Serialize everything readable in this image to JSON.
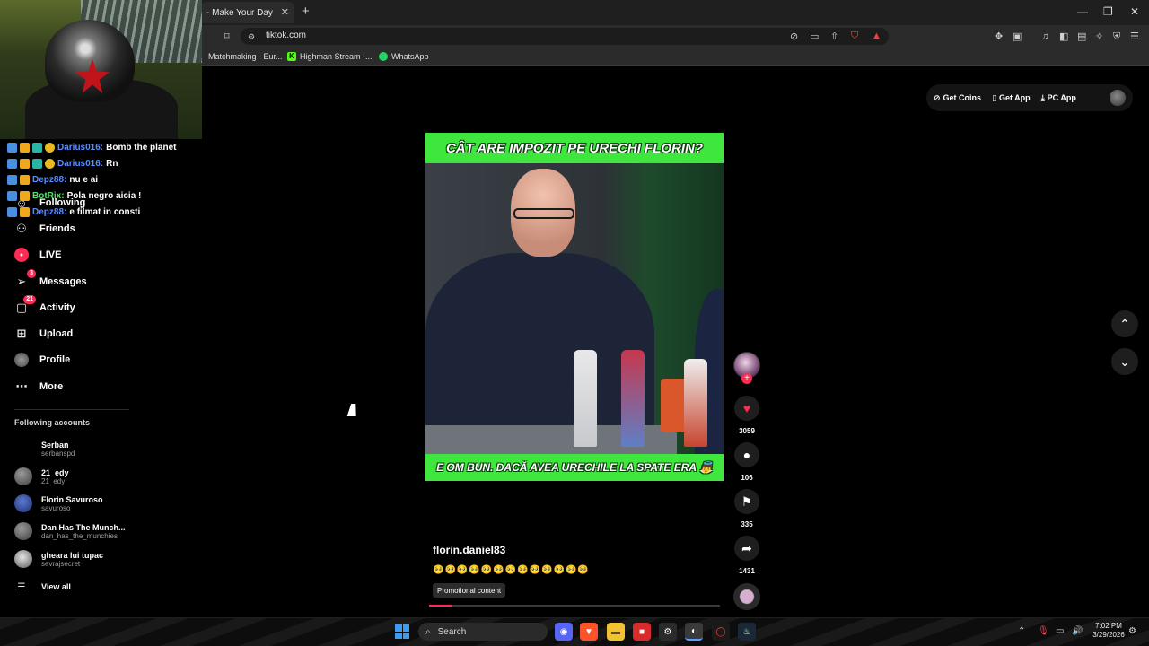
{
  "browser": {
    "tab_title": "- Make Your Day",
    "tab_close": "✕",
    "new_tab": "+",
    "url": "tiktok.com",
    "bookmarks": [
      {
        "label": "Matchmaking - Eur...",
        "icon": "bookmark-globe-icon",
        "color": "#888888"
      },
      {
        "label": "Highman Stream -...",
        "icon": "kick-icon",
        "color": "#53fc18"
      },
      {
        "label": "WhatsApp",
        "icon": "whatsapp-icon",
        "color": "#25d366"
      }
    ],
    "window_controls": [
      "—",
      "❐",
      "✕"
    ]
  },
  "chat": [
    {
      "user": "Darius016:",
      "message": "Bomb the planet",
      "user_color": "blue"
    },
    {
      "user": "Darius016:",
      "message": "Rn",
      "user_color": "blue"
    },
    {
      "user": "Depz88:",
      "message": "nu e ai",
      "user_color": "blue"
    },
    {
      "user": "BotRix:",
      "message": "Pola negro aicia !",
      "user_color": "green"
    },
    {
      "user": "Depz88:",
      "message": "e filmat in consti",
      "user_color": "blue"
    }
  ],
  "sidebar": {
    "items": [
      {
        "label": "Following",
        "icon": "following-icon"
      },
      {
        "label": "Friends",
        "icon": "friends-icon"
      },
      {
        "label": "LIVE",
        "icon": "live-icon"
      },
      {
        "label": "Messages",
        "icon": "messages-icon",
        "badge": "3"
      },
      {
        "label": "Activity",
        "icon": "activity-icon",
        "badge": "21"
      },
      {
        "label": "Upload",
        "icon": "upload-icon"
      },
      {
        "label": "Profile",
        "icon": "profile-icon"
      },
      {
        "label": "More",
        "icon": "more-icon"
      }
    ],
    "following_title": "Following accounts",
    "accounts": [
      {
        "name": "Serban",
        "handle": "serbanspd"
      },
      {
        "name": "21_edy",
        "handle": "21_edy"
      },
      {
        "name": "Florin Savuroso",
        "handle": "savuroso"
      },
      {
        "name": "Dan Has The Munch...",
        "handle": "dan_has_the_munchies"
      },
      {
        "name": "gheara lui tupac",
        "handle": "sevrajsecret"
      }
    ],
    "view_all": "View all"
  },
  "top_actions": {
    "get_coins": "Get Coins",
    "get_app": "Get App",
    "pc_app": "PC App"
  },
  "video": {
    "top_banner": "CÂT ARE IMPOZIT PE URECHI FLORIN?",
    "bottom_banner": "E OM BUN. DACĂ AVEA URECHILE LA SPATE ERA 👼",
    "author": "florin.daniel83",
    "caption_emojis": "🥺🥺🥺🥺🥺🥺🥺🥺🥺🥺🥺🥺🥺",
    "promo_label": "Promotional content",
    "progress_percent": 8,
    "likes": "3059",
    "comments": "106",
    "saves": "335",
    "shares": "1431"
  },
  "taskbar": {
    "search_placeholder": "Search",
    "time": "7:02 PM",
    "date": "3/29/2026"
  },
  "colors": {
    "accent": "#fe2c55",
    "banner_green": "#3ee63e"
  }
}
